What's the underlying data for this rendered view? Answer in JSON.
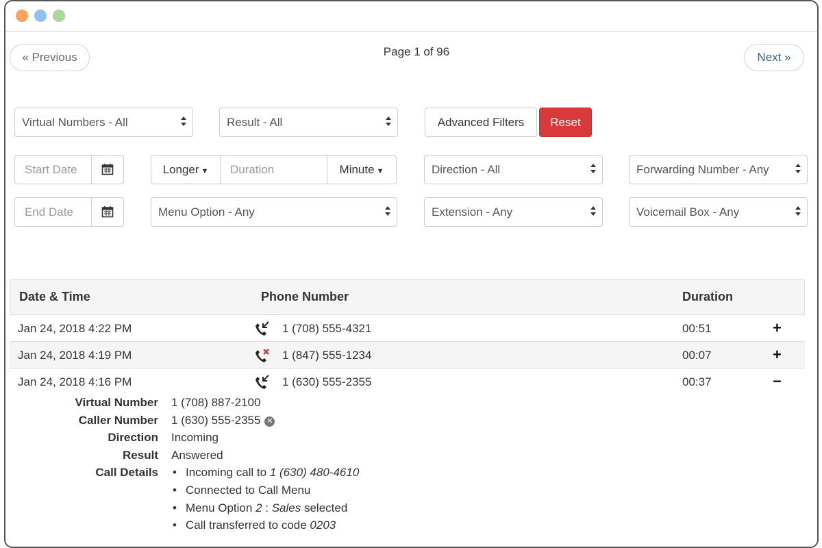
{
  "pagination": {
    "prev_label": "« Previous",
    "next_label": "Next »",
    "page_info": "Page 1 of 96"
  },
  "filters": {
    "virtual_numbers": "Virtual Numbers - All",
    "result": "Result - All",
    "advanced_filters_label": "Advanced Filters",
    "reset_label": "Reset",
    "start_date_placeholder": "Start Date",
    "end_date_placeholder": "End Date",
    "duration_compare": "Longer",
    "duration_placeholder": "Duration",
    "duration_unit": "Minute",
    "direction": "Direction - All",
    "forwarding_number": "Forwarding Number - Any",
    "menu_option": "Menu Option - Any",
    "extension": "Extension - Any",
    "voicemail_box": "Voicemail Box - Any"
  },
  "table": {
    "headers": {
      "datetime": "Date & Time",
      "phone": "Phone Number",
      "duration": "Duration"
    },
    "rows": [
      {
        "datetime": "Jan 24, 2018 4:22 PM",
        "phone": "1 (708) 555-4321",
        "duration": "00:51",
        "status_icon": "incoming-call-icon",
        "toggle": "+"
      },
      {
        "datetime": "Jan 24, 2018 4:19 PM",
        "phone": "1 (847) 555-1234",
        "duration": "00:07",
        "status_icon": "missed-call-icon",
        "toggle": "+"
      },
      {
        "datetime": "Jan 24, 2018 4:16 PM",
        "phone": "1 (630) 555-2355",
        "duration": "00:37",
        "status_icon": "incoming-call-icon",
        "toggle": "−"
      }
    ]
  },
  "details": {
    "virtual_number_label": "Virtual Number",
    "virtual_number": "1 (708) 887-2100",
    "caller_number_label": "Caller Number",
    "caller_number": "1 (630) 555-2355",
    "direction_label": "Direction",
    "direction": "Incoming",
    "result_label": "Result",
    "result": "Answered",
    "call_details_label": "Call Details",
    "call_details": {
      "line1_text": "Incoming call to ",
      "line1_number": "1 (630) 480-4610",
      "line2_text": "Connected to Call Menu",
      "line3_text": "Menu Option ",
      "line3_option": "2",
      "line3_sep": " : ",
      "line3_name": "Sales",
      "line3_suffix": " selected",
      "line4_text": "Call transferred to code ",
      "line4_code": "0203"
    }
  },
  "colors": {
    "accent_red": "#d9393a",
    "link_blue": "#2a6496",
    "missed_red": "#d9393a"
  }
}
